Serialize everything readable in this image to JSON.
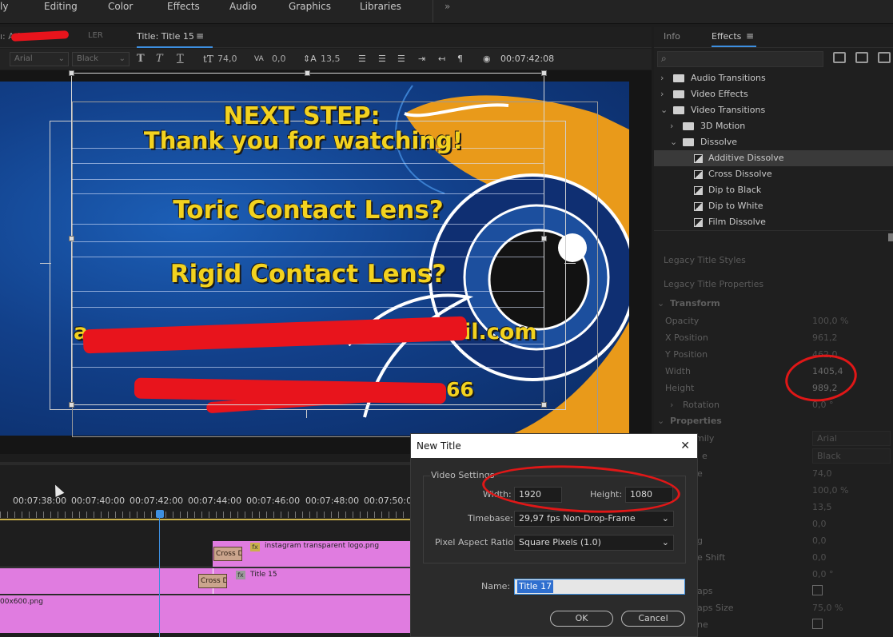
{
  "workspaces": [
    "ly",
    "Editing",
    "Color",
    "Effects",
    "Audio",
    "Graphics",
    "Libraries"
  ],
  "workspaces_more": "»",
  "title_panel": {
    "tab_left": "ı: Ari",
    "tab_left_tail": "LER",
    "tab_title": "Title: Title 15",
    "menu_icon": "≡"
  },
  "toolbar": {
    "font_family": "Arial",
    "font_style": "Black",
    "bold": "T",
    "italic": "T",
    "underline": "T",
    "font_size": "74,0",
    "kerning": "0,0",
    "leading": "13,5",
    "timecode": "00:07:42:08"
  },
  "title_text": {
    "line1": "NEXT STEP:",
    "line2": "Thank you for watching!",
    "line3": "Toric Contact Lens?",
    "line4": "Rigid Contact Lens?",
    "line5_tail": "il.com",
    "line5_head": "a",
    "line6_fragment": "66"
  },
  "right_panel": {
    "tab_info": "Info",
    "tab_effects": "Effects",
    "tab_menu": "≡",
    "tree": [
      {
        "label": "Audio Transitions",
        "type": "folder",
        "expanded": false,
        "level": 0
      },
      {
        "label": "Video Effects",
        "type": "folder",
        "expanded": false,
        "level": 0
      },
      {
        "label": "Video Transitions",
        "type": "folder",
        "expanded": true,
        "level": 0
      },
      {
        "label": "3D Motion",
        "type": "folder",
        "expanded": false,
        "level": 1
      },
      {
        "label": "Dissolve",
        "type": "folder",
        "expanded": true,
        "level": 1
      },
      {
        "label": "Additive Dissolve",
        "type": "item",
        "selected": true,
        "level": 2
      },
      {
        "label": "Cross Dissolve",
        "type": "item",
        "level": 2
      },
      {
        "label": "Dip to Black",
        "type": "item",
        "level": 2
      },
      {
        "label": "Dip to White",
        "type": "item",
        "level": 2
      },
      {
        "label": "Film Dissolve",
        "type": "item",
        "level": 2
      }
    ],
    "legacy_styles": "Legacy Title Styles",
    "legacy_props": "Legacy Title Properties",
    "transform": "Transform",
    "props": [
      {
        "label": "Opacity",
        "value": "100,0 %"
      },
      {
        "label": "X Position",
        "value": "961,2"
      },
      {
        "label": "Y Position",
        "value": "462,0"
      },
      {
        "label": "Width",
        "value": "1405,4"
      },
      {
        "label": "Height",
        "value": "989,2"
      },
      {
        "label": "Rotation",
        "value": "0,0 °"
      }
    ],
    "properties": "Properties",
    "prop2": [
      {
        "label": "mily",
        "value": "Arial"
      },
      {
        "label": "e",
        "value": "Black"
      },
      {
        "label": "e",
        "value": "74,0"
      },
      {
        "label": "",
        "value": "100,0 %"
      },
      {
        "label": "",
        "value": "13,5"
      },
      {
        "label": "",
        "value": "0,0"
      },
      {
        "label": "g",
        "value": "0,0"
      },
      {
        "label": "e Shift",
        "value": "0,0"
      },
      {
        "label": "",
        "value": "0,0 °"
      },
      {
        "label": "aps",
        "value": ""
      },
      {
        "label": "aps Size",
        "value": "75,0 %"
      },
      {
        "label": "ne",
        "value": ""
      }
    ]
  },
  "timeline": {
    "timecodes": [
      "00:07:38:00",
      "00:07:40:00",
      "00:07:42:00",
      "00:07:44:00",
      "00:07:46:00",
      "00:07:48:00",
      "00:07:50:00"
    ],
    "clips": {
      "instagram": "instagram transparent logo.png",
      "title15": "Title 15",
      "bottom": "00x600.png",
      "cross1": "Cross Di",
      "cross2": "Cross Di",
      "fx": "fx"
    }
  },
  "dialog": {
    "title": "New Title",
    "close": "✕",
    "group": "Video Settings",
    "width_label": "Width:",
    "width_value": "1920",
    "height_label": "Height:",
    "height_value": "1080",
    "timebase_label": "Timebase:",
    "timebase_value": "29,97 fps Non-Drop-Frame",
    "par_label": "Pixel Aspect Ratio:",
    "par_value": "Square Pixels (1.0)",
    "name_label": "Name:",
    "name_value": "Title 17",
    "ok": "OK",
    "cancel": "Cancel"
  },
  "colors": {
    "title_text": "#f3d21f",
    "clip": "#e07ce0",
    "annotation": "#e01717",
    "playhead": "#3d8fe0"
  }
}
